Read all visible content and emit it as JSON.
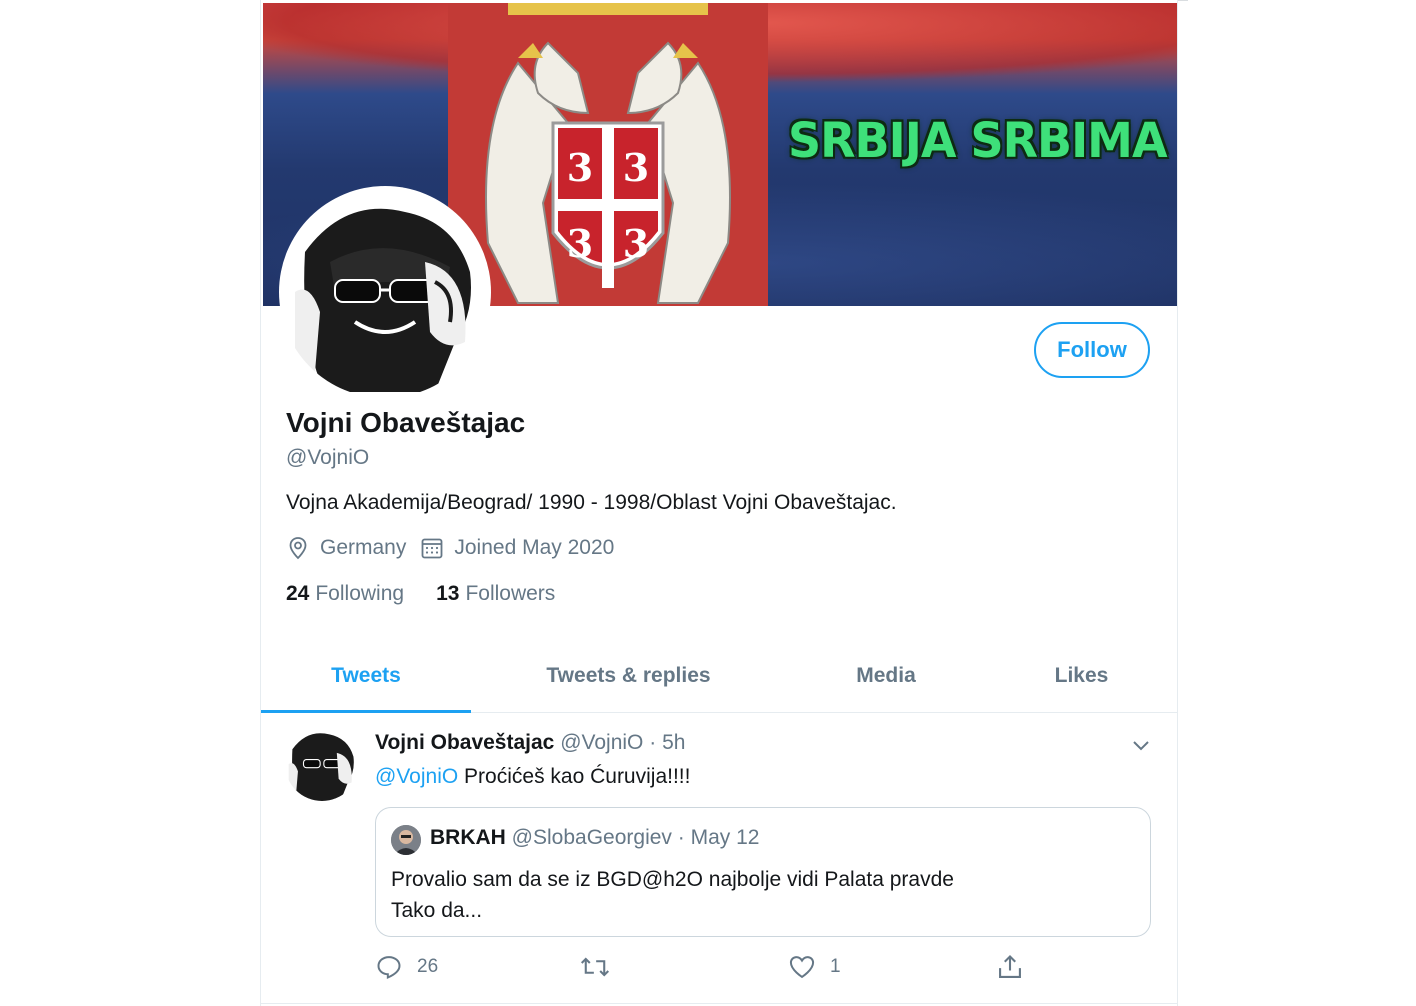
{
  "banner": {
    "slogan": "SRBIJA SRBIMA"
  },
  "profile": {
    "name": "Vojni Obaveštajac",
    "handle": "@VojniO",
    "bio": "Vojna Akademija/Beograd/ 1990 - 1998/Oblast Vojni Obaveštajac.",
    "location": "Germany",
    "joined": "Joined May 2020",
    "following_count": "24",
    "following_label": "Following",
    "followers_count": "13",
    "followers_label": "Followers",
    "follow_button": "Follow"
  },
  "tabs": [
    {
      "label": "Tweets",
      "active": true
    },
    {
      "label": "Tweets & replies",
      "active": false
    },
    {
      "label": "Media",
      "active": false
    },
    {
      "label": "Likes",
      "active": false
    }
  ],
  "tweet": {
    "author_name": "Vojni Obaveštajac",
    "author_handle": "@VojniO",
    "separator": "·",
    "time": "5h",
    "mention": "@VojniO",
    "text": "Proćićeš kao Ćuruvija!!!!",
    "quote": {
      "author_name": "BRKAH",
      "author_handle": "@SlobaGeorgiev",
      "date": "May 12",
      "line1": "Provalio sam da se iz BGD@h2O najbolje vidi Palata pravde",
      "line2": "Tako da..."
    },
    "reply_count": "26",
    "retweet_count": "",
    "like_count": "1"
  },
  "colors": {
    "accent": "#1da1f2",
    "secondary_text": "#657786",
    "slogan_green": "#3ee07a"
  },
  "icons": [
    "location-icon",
    "calendar-icon",
    "chevron-down-icon",
    "reply-icon",
    "retweet-icon",
    "like-icon",
    "share-icon"
  ]
}
